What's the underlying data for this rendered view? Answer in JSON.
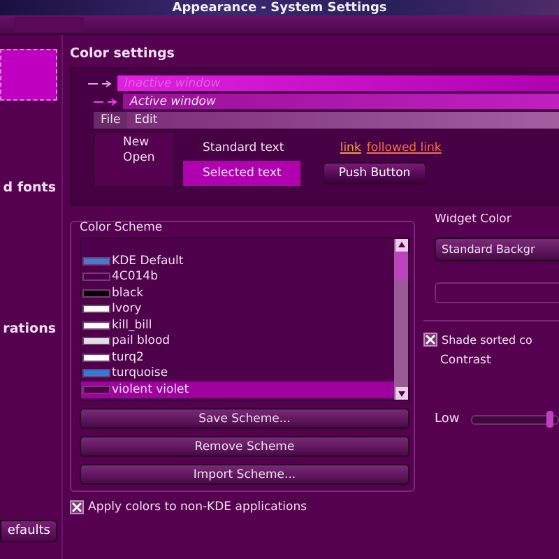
{
  "window": {
    "title": "Appearance - System Settings"
  },
  "sidebar": {
    "items": [
      {
        "label": "d fonts",
        "selected": false
      },
      {
        "label": "rations",
        "selected": false
      }
    ],
    "defaults_button": "efaults"
  },
  "color_settings": {
    "heading": "Color settings",
    "preview": {
      "inactive_title": "Inactive window",
      "active_title": "Active window",
      "menu": [
        {
          "label": "File",
          "selected": true
        },
        {
          "label": "Edit",
          "selected": false
        }
      ],
      "menu_items": [
        "New",
        "Open"
      ],
      "standard_text": "Standard text",
      "selected_text": "Selected text",
      "link": "link",
      "followed_link": "followed link",
      "push_button": "Push Button"
    },
    "color_scheme": {
      "label": "Color Scheme",
      "items": [
        {
          "name": "KDE Default",
          "color": "#3a7fd0",
          "selected": false
        },
        {
          "name": "4C014b",
          "color": "#4c014b",
          "selected": false
        },
        {
          "name": "black",
          "color": "#000000",
          "selected": false
        },
        {
          "name": "Ivory",
          "color": "#fffff0",
          "selected": false
        },
        {
          "name": "kill_bill",
          "color": "#ffffff",
          "selected": false
        },
        {
          "name": "pail blood",
          "color": "#e0e0e0",
          "selected": false
        },
        {
          "name": "turq2",
          "color": "#ffffff",
          "selected": false
        },
        {
          "name": "turquoise",
          "color": "#2a7fd8",
          "selected": false
        },
        {
          "name": "violent violet",
          "color": "#4c014b",
          "selected": true
        }
      ],
      "buttons": [
        "Save Scheme...",
        "Remove Scheme",
        "Import Scheme..."
      ]
    },
    "widget_color": {
      "label": "Widget Color",
      "dropdown": "Standard Backgr",
      "shade_sorted": {
        "label": "Shade sorted co",
        "checked": true
      },
      "contrast": {
        "label": "Contrast",
        "low_label": "Low",
        "level": 0.95
      }
    },
    "apply_colors": {
      "label": "Apply colors to non-KDE applications",
      "checked": true
    }
  }
}
